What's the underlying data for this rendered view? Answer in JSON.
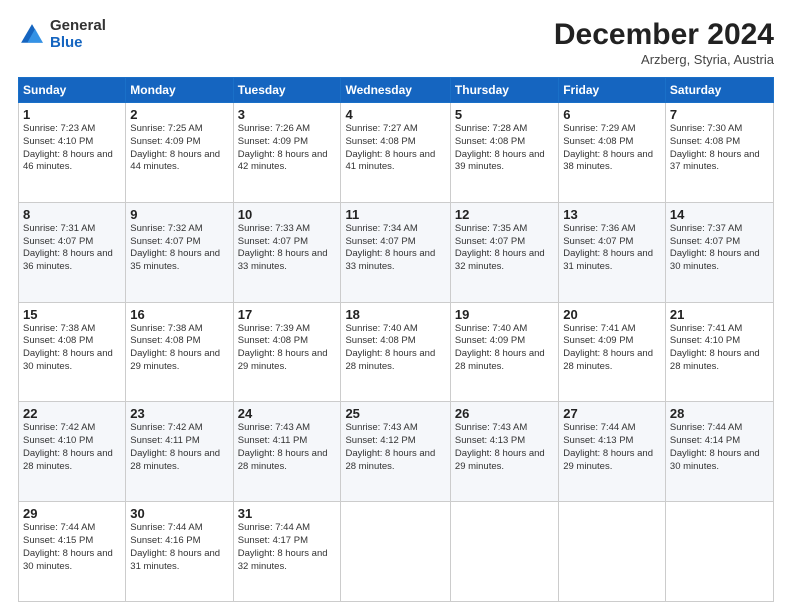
{
  "logo": {
    "general": "General",
    "blue": "Blue"
  },
  "header": {
    "month": "December 2024",
    "location": "Arzberg, Styria, Austria"
  },
  "weekdays": [
    "Sunday",
    "Monday",
    "Tuesday",
    "Wednesday",
    "Thursday",
    "Friday",
    "Saturday"
  ],
  "weeks": [
    [
      {
        "day": "1",
        "sunrise": "7:23 AM",
        "sunset": "4:10 PM",
        "daylight": "8 hours and 46 minutes."
      },
      {
        "day": "2",
        "sunrise": "7:25 AM",
        "sunset": "4:09 PM",
        "daylight": "8 hours and 44 minutes."
      },
      {
        "day": "3",
        "sunrise": "7:26 AM",
        "sunset": "4:09 PM",
        "daylight": "8 hours and 42 minutes."
      },
      {
        "day": "4",
        "sunrise": "7:27 AM",
        "sunset": "4:08 PM",
        "daylight": "8 hours and 41 minutes."
      },
      {
        "day": "5",
        "sunrise": "7:28 AM",
        "sunset": "4:08 PM",
        "daylight": "8 hours and 39 minutes."
      },
      {
        "day": "6",
        "sunrise": "7:29 AM",
        "sunset": "4:08 PM",
        "daylight": "8 hours and 38 minutes."
      },
      {
        "day": "7",
        "sunrise": "7:30 AM",
        "sunset": "4:08 PM",
        "daylight": "8 hours and 37 minutes."
      }
    ],
    [
      {
        "day": "8",
        "sunrise": "7:31 AM",
        "sunset": "4:07 PM",
        "daylight": "8 hours and 36 minutes."
      },
      {
        "day": "9",
        "sunrise": "7:32 AM",
        "sunset": "4:07 PM",
        "daylight": "8 hours and 35 minutes."
      },
      {
        "day": "10",
        "sunrise": "7:33 AM",
        "sunset": "4:07 PM",
        "daylight": "8 hours and 33 minutes."
      },
      {
        "day": "11",
        "sunrise": "7:34 AM",
        "sunset": "4:07 PM",
        "daylight": "8 hours and 33 minutes."
      },
      {
        "day": "12",
        "sunrise": "7:35 AM",
        "sunset": "4:07 PM",
        "daylight": "8 hours and 32 minutes."
      },
      {
        "day": "13",
        "sunrise": "7:36 AM",
        "sunset": "4:07 PM",
        "daylight": "8 hours and 31 minutes."
      },
      {
        "day": "14",
        "sunrise": "7:37 AM",
        "sunset": "4:07 PM",
        "daylight": "8 hours and 30 minutes."
      }
    ],
    [
      {
        "day": "15",
        "sunrise": "7:38 AM",
        "sunset": "4:08 PM",
        "daylight": "8 hours and 30 minutes."
      },
      {
        "day": "16",
        "sunrise": "7:38 AM",
        "sunset": "4:08 PM",
        "daylight": "8 hours and 29 minutes."
      },
      {
        "day": "17",
        "sunrise": "7:39 AM",
        "sunset": "4:08 PM",
        "daylight": "8 hours and 29 minutes."
      },
      {
        "day": "18",
        "sunrise": "7:40 AM",
        "sunset": "4:08 PM",
        "daylight": "8 hours and 28 minutes."
      },
      {
        "day": "19",
        "sunrise": "7:40 AM",
        "sunset": "4:09 PM",
        "daylight": "8 hours and 28 minutes."
      },
      {
        "day": "20",
        "sunrise": "7:41 AM",
        "sunset": "4:09 PM",
        "daylight": "8 hours and 28 minutes."
      },
      {
        "day": "21",
        "sunrise": "7:41 AM",
        "sunset": "4:10 PM",
        "daylight": "8 hours and 28 minutes."
      }
    ],
    [
      {
        "day": "22",
        "sunrise": "7:42 AM",
        "sunset": "4:10 PM",
        "daylight": "8 hours and 28 minutes."
      },
      {
        "day": "23",
        "sunrise": "7:42 AM",
        "sunset": "4:11 PM",
        "daylight": "8 hours and 28 minutes."
      },
      {
        "day": "24",
        "sunrise": "7:43 AM",
        "sunset": "4:11 PM",
        "daylight": "8 hours and 28 minutes."
      },
      {
        "day": "25",
        "sunrise": "7:43 AM",
        "sunset": "4:12 PM",
        "daylight": "8 hours and 28 minutes."
      },
      {
        "day": "26",
        "sunrise": "7:43 AM",
        "sunset": "4:13 PM",
        "daylight": "8 hours and 29 minutes."
      },
      {
        "day": "27",
        "sunrise": "7:44 AM",
        "sunset": "4:13 PM",
        "daylight": "8 hours and 29 minutes."
      },
      {
        "day": "28",
        "sunrise": "7:44 AM",
        "sunset": "4:14 PM",
        "daylight": "8 hours and 30 minutes."
      }
    ],
    [
      {
        "day": "29",
        "sunrise": "7:44 AM",
        "sunset": "4:15 PM",
        "daylight": "8 hours and 30 minutes."
      },
      {
        "day": "30",
        "sunrise": "7:44 AM",
        "sunset": "4:16 PM",
        "daylight": "8 hours and 31 minutes."
      },
      {
        "day": "31",
        "sunrise": "7:44 AM",
        "sunset": "4:17 PM",
        "daylight": "8 hours and 32 minutes."
      },
      null,
      null,
      null,
      null
    ]
  ]
}
